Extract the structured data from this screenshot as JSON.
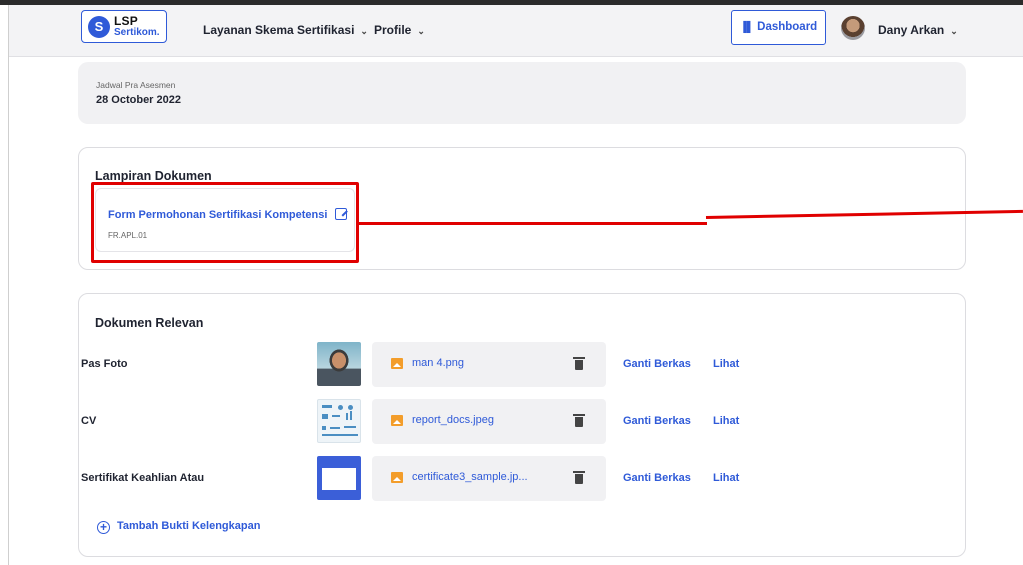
{
  "brand": {
    "line1": "LSP",
    "line2": "Sertikom.",
    "mark": "S"
  },
  "nav": {
    "items": [
      "Layanan Skema Sertifikasi",
      "Profile"
    ],
    "dashboard": "Dashboard",
    "user": "Dany Arkan"
  },
  "schedule": {
    "label": "Jadwal Pra Asesmen",
    "date": "28 October 2022"
  },
  "attachments": {
    "title": "Lampiran Dokumen",
    "doc": {
      "title": "Form Permohonan Sertifikasi Kompetensi",
      "code": "FR.APL.01"
    }
  },
  "relevant": {
    "title": "Dokumen Relevan",
    "rows": [
      {
        "label": "Pas Foto",
        "file": "man 4.png",
        "replace": "Ganti Berkas",
        "view": "Lihat"
      },
      {
        "label": "CV",
        "file": "report_docs.jpeg",
        "replace": "Ganti Berkas",
        "view": "Lihat"
      },
      {
        "label": "Sertifikat Keahlian Atau",
        "file": "certificate3_sample.jp...",
        "replace": "Ganti Berkas",
        "view": "Lihat"
      }
    ],
    "add": "Tambah Bukti Kelengkapan"
  },
  "colors": {
    "accent": "#2f5ad8",
    "annotation": "#e00000"
  }
}
